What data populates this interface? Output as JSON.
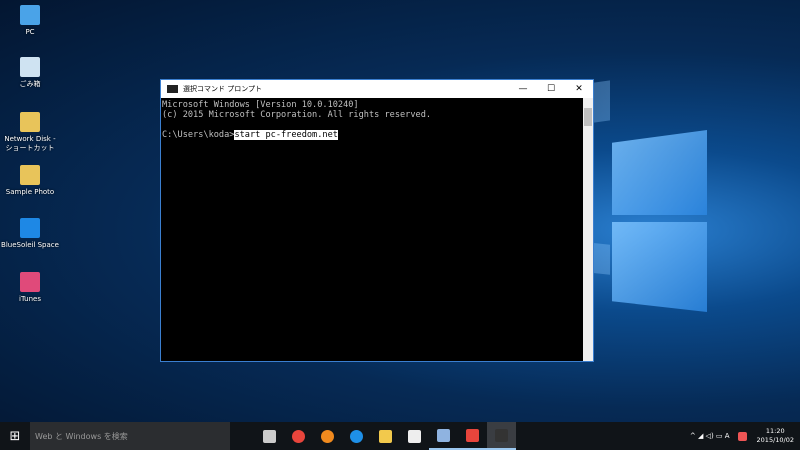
{
  "desktop_icons": [
    {
      "label": "PC",
      "color": "#4aa3e8"
    },
    {
      "label": "ごみ箱",
      "color": "#cfe3f2"
    },
    {
      "label": "Network Disk - ショートカット",
      "color": "#e8c45a"
    },
    {
      "label": "Sample Photo",
      "color": "#e8c45a"
    },
    {
      "label": "BlueSoleil Space",
      "color": "#1e88e5"
    },
    {
      "label": "iTunes",
      "color": "#e04a7a"
    }
  ],
  "console": {
    "title": "選択コマンド プロンプト",
    "controls": {
      "minimize": "—",
      "maximize": "☐",
      "close": "✕"
    },
    "lines": [
      "Microsoft Windows [Version 10.0.10240]",
      "(c) 2015 Microsoft Corporation. All rights reserved."
    ],
    "prompt": "C:\\Users\\koda>",
    "selected_command": "start pc-freedom.net"
  },
  "taskbar": {
    "start": "⊞",
    "search_placeholder": "Web と Windows を検索",
    "apps": [
      {
        "name": "task-view",
        "color": "#ccc"
      },
      {
        "name": "chrome",
        "color": "#e8453c"
      },
      {
        "name": "firefox",
        "color": "#f08a1e"
      },
      {
        "name": "edge",
        "color": "#1e90e8"
      },
      {
        "name": "file-explorer",
        "color": "#f2c94c"
      },
      {
        "name": "store",
        "color": "#eee"
      },
      {
        "name": "paint-app",
        "color": "#8fb3e0"
      },
      {
        "name": "chrome-app",
        "color": "#e8453c"
      },
      {
        "name": "command-prompt",
        "color": "#333"
      }
    ],
    "tray_icons": "^  ◢ ◁) ▭ A",
    "time": "11:20",
    "date": "2015/10/02"
  }
}
